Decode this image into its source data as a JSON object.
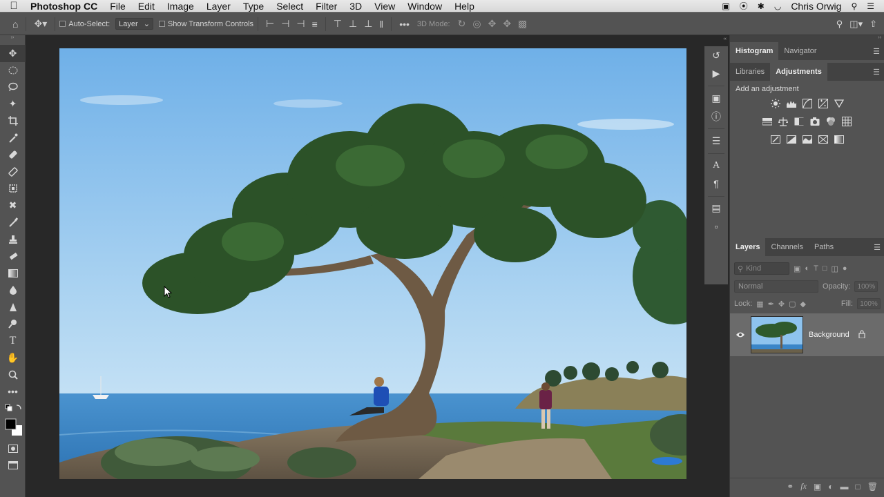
{
  "menubar": {
    "app_name": "Photoshop CC",
    "items": [
      "File",
      "Edit",
      "Image",
      "Layer",
      "Type",
      "Select",
      "Filter",
      "3D",
      "View",
      "Window",
      "Help"
    ],
    "user": "Chris Orwig"
  },
  "options_bar": {
    "auto_select_label": "Auto-Select:",
    "auto_select_value": "Layer",
    "auto_select_checked": false,
    "transform_label": "Show Transform Controls",
    "transform_checked": false,
    "mode_3d_label": "3D Mode:"
  },
  "panels": {
    "top_tabs": [
      "Histogram",
      "Navigator"
    ],
    "top_active": "Histogram",
    "mid_tabs": [
      "Libraries",
      "Adjustments"
    ],
    "mid_active": "Adjustments",
    "adjustments_label": "Add an adjustment",
    "layers_tabs": [
      "Layers",
      "Channels",
      "Paths"
    ],
    "layers_active": "Layers",
    "kind_placeholder": "Kind",
    "blend_mode": "Normal",
    "opacity_label": "Opacity:",
    "opacity_value": "100%",
    "lock_label": "Lock:",
    "fill_label": "Fill:",
    "fill_value": "100%",
    "layer_name": "Background"
  },
  "colors": {
    "ui_dark": "#282828",
    "ui_panel": "#535353",
    "ui_tabbar": "#424242",
    "layer_selected": "#6b6b6b",
    "sky_top": "#7db6e8",
    "sea": "#3f86c4"
  }
}
